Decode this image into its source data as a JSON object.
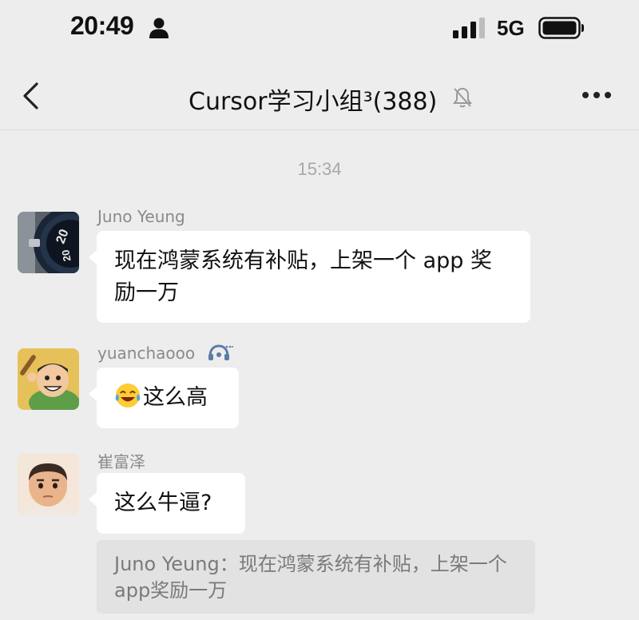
{
  "status_bar": {
    "time": "20:49",
    "network": "5G"
  },
  "nav": {
    "title": "Cursor学习小组³(388)"
  },
  "chat": {
    "timestamp": "15:34",
    "messages": [
      {
        "sender": "Juno Yeung",
        "text": "现在鸿蒙系统有补贴，上架一个 app 奖励一万"
      },
      {
        "sender": "yuanchaooo",
        "text": "这么高"
      },
      {
        "sender": "崔富泽",
        "text": "这么牛逼?"
      }
    ],
    "quote": {
      "text": "Juno Yeung：现在鸿蒙系统有补贴，上架一个app奖励一万"
    }
  },
  "icons": {
    "status": [
      "person-icon",
      "signal-icon",
      "battery-icon"
    ],
    "nav": [
      "back-icon",
      "mute-icon",
      "more-icon"
    ],
    "badge": "headset-badge-icon",
    "emoji": "laughing-tears-emoji"
  },
  "colors": {
    "background": "#EDEDED",
    "bubble": "#FFFFFF",
    "quote_bg": "#E2E2E2",
    "secondary_text": "#8A8A8A"
  }
}
